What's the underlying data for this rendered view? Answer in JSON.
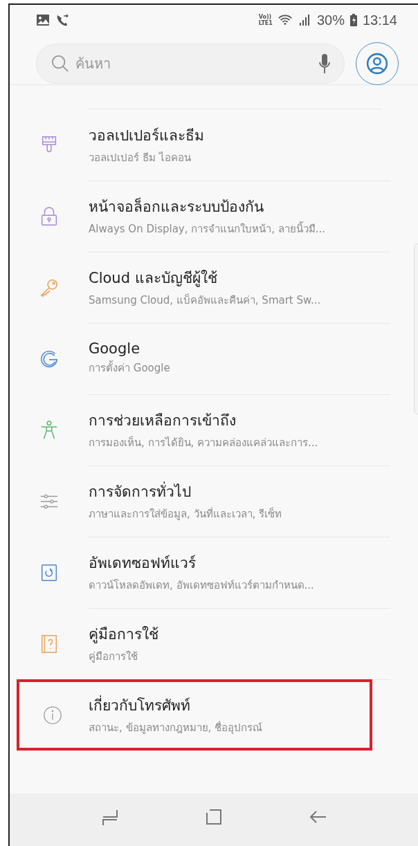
{
  "status_bar": {
    "time": "13:14",
    "battery": "30%",
    "network": "Vo))\nLTE1"
  },
  "search": {
    "placeholder": "ค้นหา"
  },
  "items": [
    {
      "kind": "brush",
      "color": "#a98bd6",
      "title": "วอลเปเปอร์และธีม",
      "subtitle": "วอลเปเปอร์ ธีม ไอคอน",
      "highlighted": false
    },
    {
      "kind": "lock",
      "color": "#a98bd6",
      "title": "หน้าจอล็อกและระบบป้องกัน",
      "subtitle": "Always On Display, การจำแนกใบหน้า, ลายนิ้วมื...",
      "highlighted": false
    },
    {
      "kind": "key",
      "color": "#eaa155",
      "title": "Cloud และบัญชีผู้ใช้",
      "subtitle": "Samsung Cloud, แบ็คอัพและคืนค่า, Smart Sw...",
      "highlighted": false
    },
    {
      "kind": "google",
      "color": "#5c8fd9",
      "title": "Google",
      "subtitle": "การตั้งค่า Google",
      "highlighted": false
    },
    {
      "kind": "accessibility",
      "color": "#58b86e",
      "title": "การช่วยเหลือการเข้าถึง",
      "subtitle": "การมองเห็น, การได้ยิน, ความคล่องแคล่วและการ...",
      "highlighted": false
    },
    {
      "kind": "sliders",
      "color": "#9a9a9a",
      "title": "การจัดการทั่วไป",
      "subtitle": "ภาษาและการใส่ข้อมูล, วันที่และเวลา, รีเซ็ท",
      "highlighted": false
    },
    {
      "kind": "update",
      "color": "#4a86d1",
      "title": "อัพเดทซอฟท์แวร์",
      "subtitle": "ดาวน์โหลดอัพเดท, อัพเดทซอฟท์แวร์ตามกำหนด...",
      "highlighted": false
    },
    {
      "kind": "manual",
      "color": "#e6a55c",
      "title": "คู่มือการใช้",
      "subtitle": "คู่มือการใช้",
      "highlighted": false
    },
    {
      "kind": "info",
      "color": "#9a9a9a",
      "title": "เกี่ยวกับโทรศัพท์",
      "subtitle": "สถานะ, ข้อมูลทางกฎหมาย, ชื่ออุปกรณ์",
      "highlighted": true
    }
  ]
}
